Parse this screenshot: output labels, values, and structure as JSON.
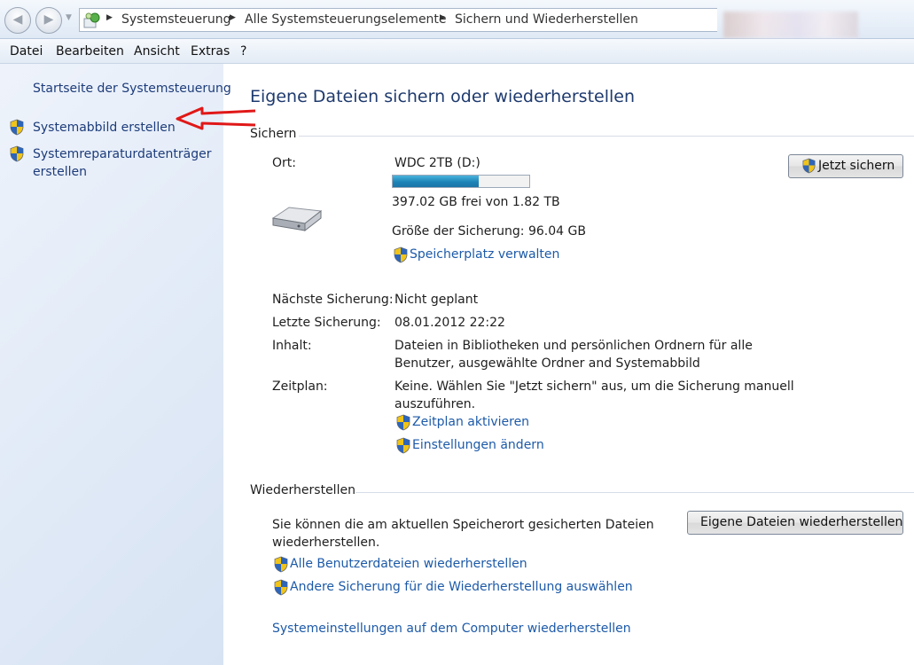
{
  "window": {
    "breadcrumbs": [
      "Systemsteuerung",
      "Alle Systemsteuerungselemente",
      "Sichern und Wiederherstellen"
    ]
  },
  "menu": [
    "Datei",
    "Bearbeiten",
    "Ansicht",
    "Extras",
    "?"
  ],
  "sidebar": {
    "home_link": "Startseite der Systemsteuerung",
    "items": [
      {
        "label": "Systemabbild erstellen",
        "icon": "uac-shield-icon"
      },
      {
        "label": "Systemreparaturdatenträger erstellen",
        "icon": "uac-shield-icon"
      }
    ]
  },
  "main": {
    "title": "Eigene Dateien sichern oder wiederherstellen",
    "backup": {
      "heading": "Sichern",
      "location_label": "Ort:",
      "drive_name": "WDC 2TB (D:)",
      "drive_used_fraction": 0.63,
      "free_space": "397.02 GB frei von 1.82 TB",
      "backup_size": "Größe der Sicherung: 96.04 GB",
      "manage_space_link": "Speicherplatz verwalten",
      "backup_now_button": "Jetzt sichern",
      "next_label": "Nächste Sicherung:",
      "next_value": "Nicht geplant",
      "last_label": "Letzte Sicherung:",
      "last_value": "08.01.2012 22:22",
      "contents_label": "Inhalt:",
      "contents_line1": "Dateien in Bibliotheken und persönlichen Ordnern für alle",
      "contents_line2": "Benutzer, ausgewählte Ordner and Systemabbild",
      "schedule_label": "Zeitplan:",
      "schedule_line1": "Keine. Wählen Sie \"Jetzt sichern\" aus, um die Sicherung manuell",
      "schedule_line2": "auszuführen.",
      "enable_schedule_link": "Zeitplan aktivieren",
      "change_settings_link": "Einstellungen ändern"
    },
    "restore": {
      "heading": "Wiederherstellen",
      "text_line1": "Sie können die am aktuellen Speicherort gesicherten Dateien",
      "text_line2": "wiederherstellen.",
      "restore_button": "Eigene Dateien wiederherstellen",
      "all_users_link": "Alle Benutzerdateien wiederherstellen",
      "other_backup_link": "Andere Sicherung für die Wiederherstellung auswählen",
      "system_settings_link": "Systemeinstellungen auf dem Computer wiederherstellen"
    }
  },
  "colors": {
    "link": "#1d5aa8",
    "title": "#1e3a6e",
    "annotation_arrow": "#e01818"
  }
}
